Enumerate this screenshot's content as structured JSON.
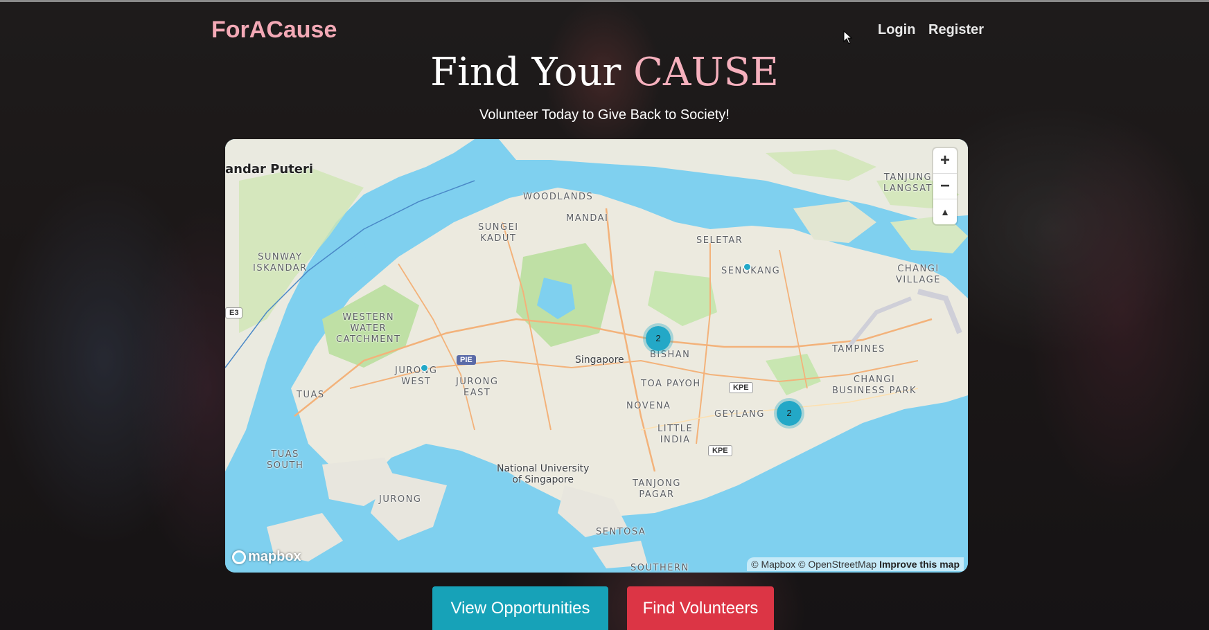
{
  "header": {
    "brand": "ForACause",
    "nav": {
      "login": "Login",
      "register": "Register"
    }
  },
  "hero": {
    "title_prefix": "Find Your",
    "title_accent": "CAUSE",
    "subtitle": "Volunteer Today to Give Back to Society!"
  },
  "map": {
    "labels": {
      "bandar_puteri": "andar Puteri",
      "woodlands": "WOODLANDS",
      "mandai": "MANDAI",
      "sungei_kadut": "SUNGEI\nKADUT",
      "seletar": "SELETAR",
      "sengkang": "SENGKANG",
      "sunway_iskandar": "SUNWAY\nISKANDAR",
      "tanjung_langsat": "TANJUNG\nLANGSAT",
      "changi_village": "CHANGI\nVILLAGE",
      "western_water_catchment": "WESTERN\nWATER\nCATCHMENT",
      "jurong_west": "JURONG\nWEST",
      "jurong_east": "JURONG\nEAST",
      "singapore": "Singapore",
      "bishan": "BISHAN",
      "toa_payoh": "TOA PAYOH",
      "tampines": "TAMPINES",
      "changi_business_park": "CHANGI\nBUSINESS PARK",
      "tuas": "TUAS",
      "novena": "NOVENA",
      "geylang": "GEYLANG",
      "little_india": "LITTLE\nINDIA",
      "tuas_south": "TUAS\nSOUTH",
      "nus": "National University\nof Singapore",
      "jurong": "JURONG",
      "tanjong_pagar": "TANJONG\nPAGAR",
      "sentosa": "SENTOSA",
      "southern": "SOUTHERN"
    },
    "shields": {
      "pie": "PIE",
      "kpe1": "KPE",
      "kpe2": "KPE",
      "e3": "E3"
    },
    "clusters": [
      {
        "count": "2"
      },
      {
        "count": "2"
      }
    ],
    "controls": {
      "zoom_in": "+",
      "zoom_out": "−",
      "compass": "▲"
    },
    "logo": "mapbox",
    "attribution": {
      "text": "© Mapbox © OpenStreetMap",
      "improve": "Improve this map"
    }
  },
  "actions": {
    "view_opportunities": "View Opportunities",
    "find_volunteers": "Find Volunteers"
  },
  "colors": {
    "brand_pink": "#f3a9b6",
    "info": "#17a2b8",
    "danger": "#dc3545",
    "water": "#7fd0ef"
  }
}
